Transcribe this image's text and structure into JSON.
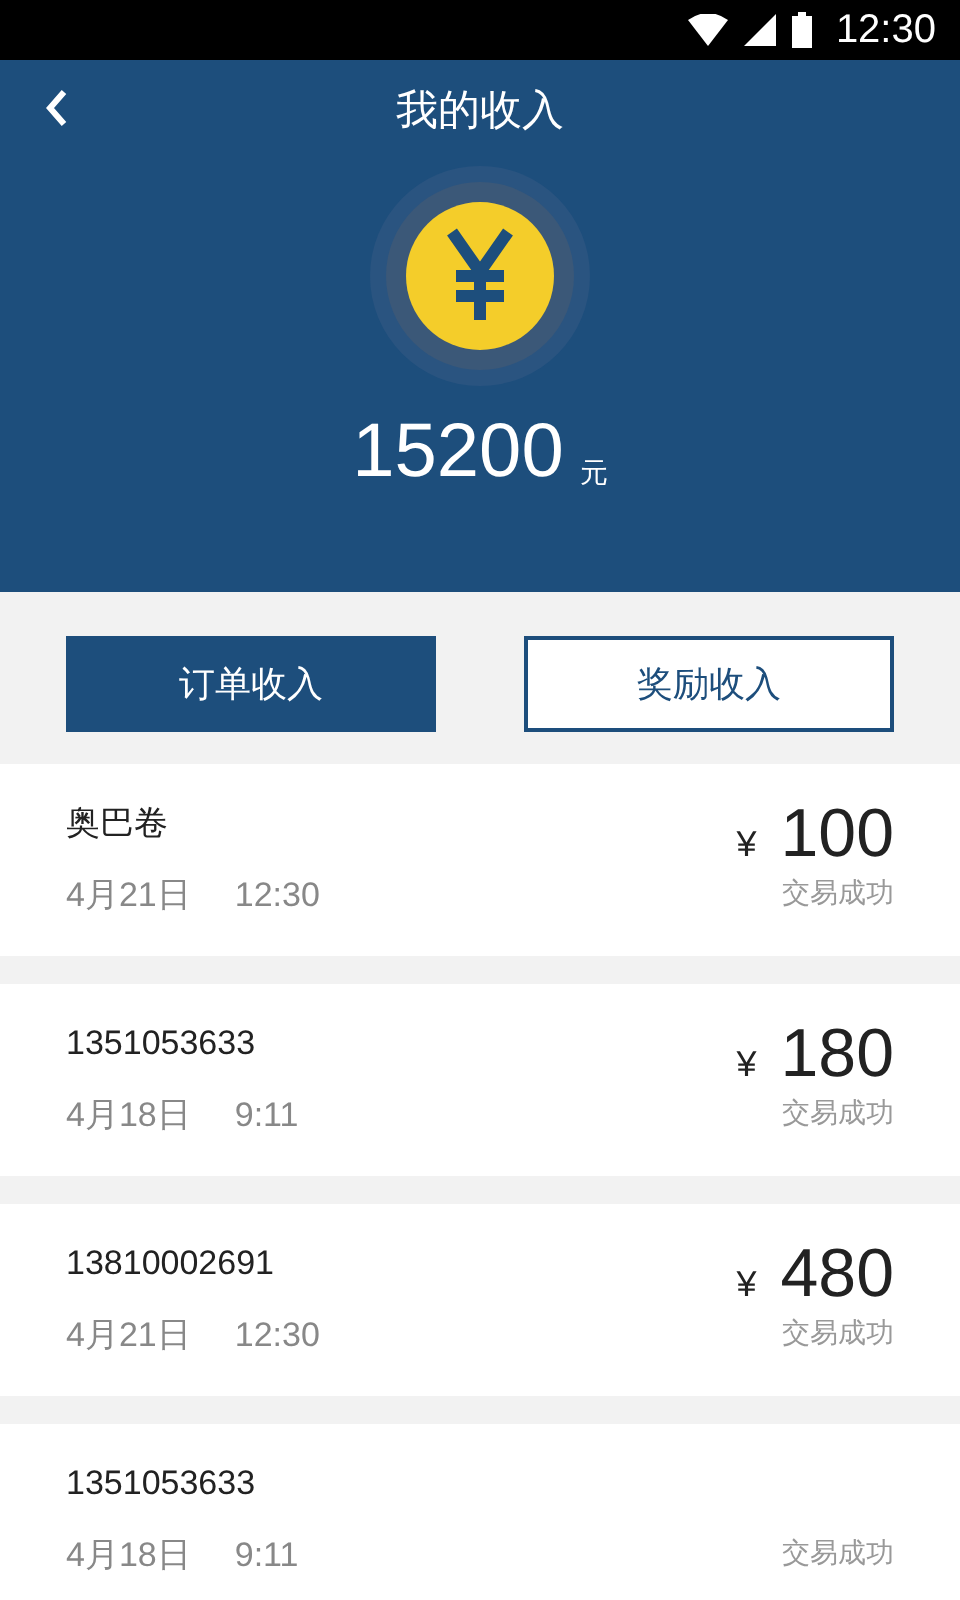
{
  "status_bar": {
    "time": "12:30"
  },
  "header": {
    "title": "我的收入",
    "total": "15200",
    "unit": "元"
  },
  "tabs": [
    {
      "label": "订单收入",
      "selected": true
    },
    {
      "label": "奖励收入",
      "selected": false
    }
  ],
  "records": [
    {
      "name": "奥巴卷",
      "date": "4月21日",
      "time": "12:30",
      "currency": "¥",
      "amount": "100",
      "status": "交易成功"
    },
    {
      "name": "1351053633",
      "date": "4月18日",
      "time": "9:11",
      "currency": "¥",
      "amount": "180",
      "status": "交易成功"
    },
    {
      "name": "13810002691",
      "date": "4月21日",
      "time": "12:30",
      "currency": "¥",
      "amount": "480",
      "status": "交易成功"
    },
    {
      "name": "1351053633",
      "date": "4月18日",
      "time": "9:11",
      "status": "交易成功"
    }
  ]
}
